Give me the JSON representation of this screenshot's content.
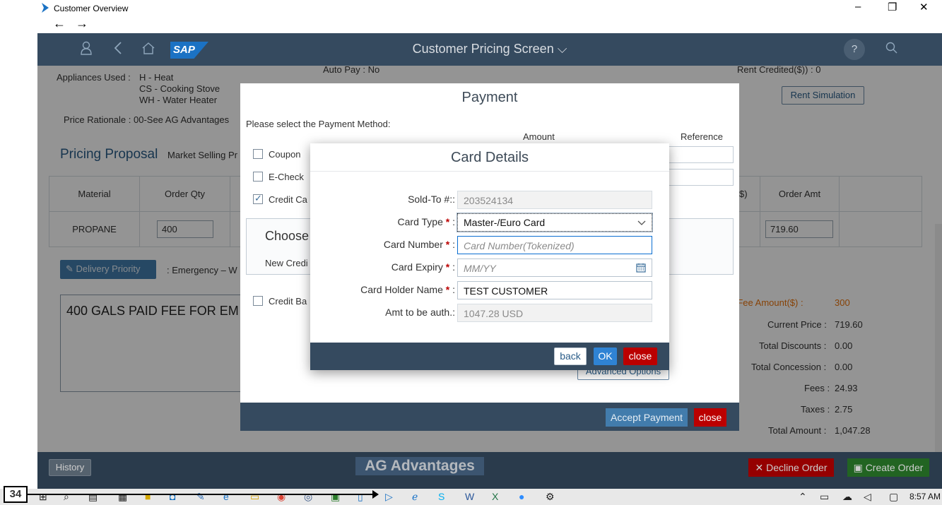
{
  "window": {
    "title": "Customer Overview",
    "minimize": "–",
    "restore": "❐",
    "close": "✕",
    "back_arrow": "←",
    "forward_arrow": "→"
  },
  "shell": {
    "title": "Customer Pricing Screen ⌵",
    "logo": "SAP",
    "help": "?"
  },
  "background": {
    "appliances_label": "Appliances Used :",
    "appliances": [
      "H - Heat",
      "CS - Cooking Stove",
      "WH - Water Heater"
    ],
    "auto_pay": "Auto Pay : No",
    "rent_credited": "Rent Credited($)) : 0",
    "rent_simulation": "Rent Simulation",
    "price_rationale": "Price Rationale : 00-See AG Advantages",
    "pricing_proposal": "Pricing Proposal",
    "market_selling": "Market Selling Pr",
    "table_headers": {
      "material": "Material",
      "order_qty": "Order Qty",
      "right_partial": "$)",
      "order_amt": "Order Amt"
    },
    "row": {
      "material": "PROPANE",
      "qty": "400",
      "amt": "719.60"
    },
    "delivery_priority": "Delivery Priority",
    "delivery_value": ": Emergency – W",
    "notes": "400 GALS PAID FEE FOR EM",
    "totals": [
      {
        "label": "ecial Fee Amount($) :",
        "value": "300"
      },
      {
        "label": "Current Price :",
        "value": "719.60"
      },
      {
        "label": "Total Discounts :",
        "value": "0.00"
      },
      {
        "label": "Total Concession :",
        "value": "0.00"
      },
      {
        "label": "Fees :",
        "value": "24.93"
      },
      {
        "label": "Taxes :",
        "value": "2.75"
      },
      {
        "label": "Total Amount :",
        "value": "1,047.28"
      }
    ],
    "history": "History",
    "ag_advantages": "AG Advantages",
    "decline_order": "✕ Decline Order",
    "create_order": "▣ Create Order"
  },
  "payment": {
    "title": "Payment",
    "instruction": "Please select the Payment Method:",
    "amount_header": "Amount",
    "reference_header": "Reference",
    "methods": [
      "Coupon",
      "E-Check",
      "Credit Ca",
      "Credit Ba"
    ],
    "credit_card_checked": true,
    "choose": "Choose",
    "new_credit": "New Credi",
    "advanced_options": "Advanced Options",
    "accept_payment": "Accept Payment",
    "close": "close"
  },
  "card": {
    "title": "Card Details",
    "fields": {
      "sold_to": {
        "label": "Sold-To #::",
        "value": "203524134"
      },
      "card_type": {
        "label": "Card Type",
        "value": "Master-/Euro Card"
      },
      "card_number": {
        "label": "Card Number",
        "placeholder": "Card Number(Tokenized)"
      },
      "card_expiry": {
        "label": "Card Expiry",
        "placeholder": "MM/YY"
      },
      "holder_name": {
        "label": "Card Holder Name",
        "value": "TEST CUSTOMER"
      },
      "amt_auth": {
        "label": "Amt to be auth.:",
        "value": "1047.28 USD"
      }
    },
    "required_mark": "*",
    "colon": ":",
    "back": "back",
    "ok": "OK",
    "close": "close"
  },
  "taskbar": {
    "time": "8:57 AM"
  },
  "annotation": {
    "step": "34"
  },
  "colors": {
    "shell": "#354a5f",
    "accent": "#0a6ed1",
    "reject": "#bb0000",
    "accept": "#2b7d2b"
  }
}
